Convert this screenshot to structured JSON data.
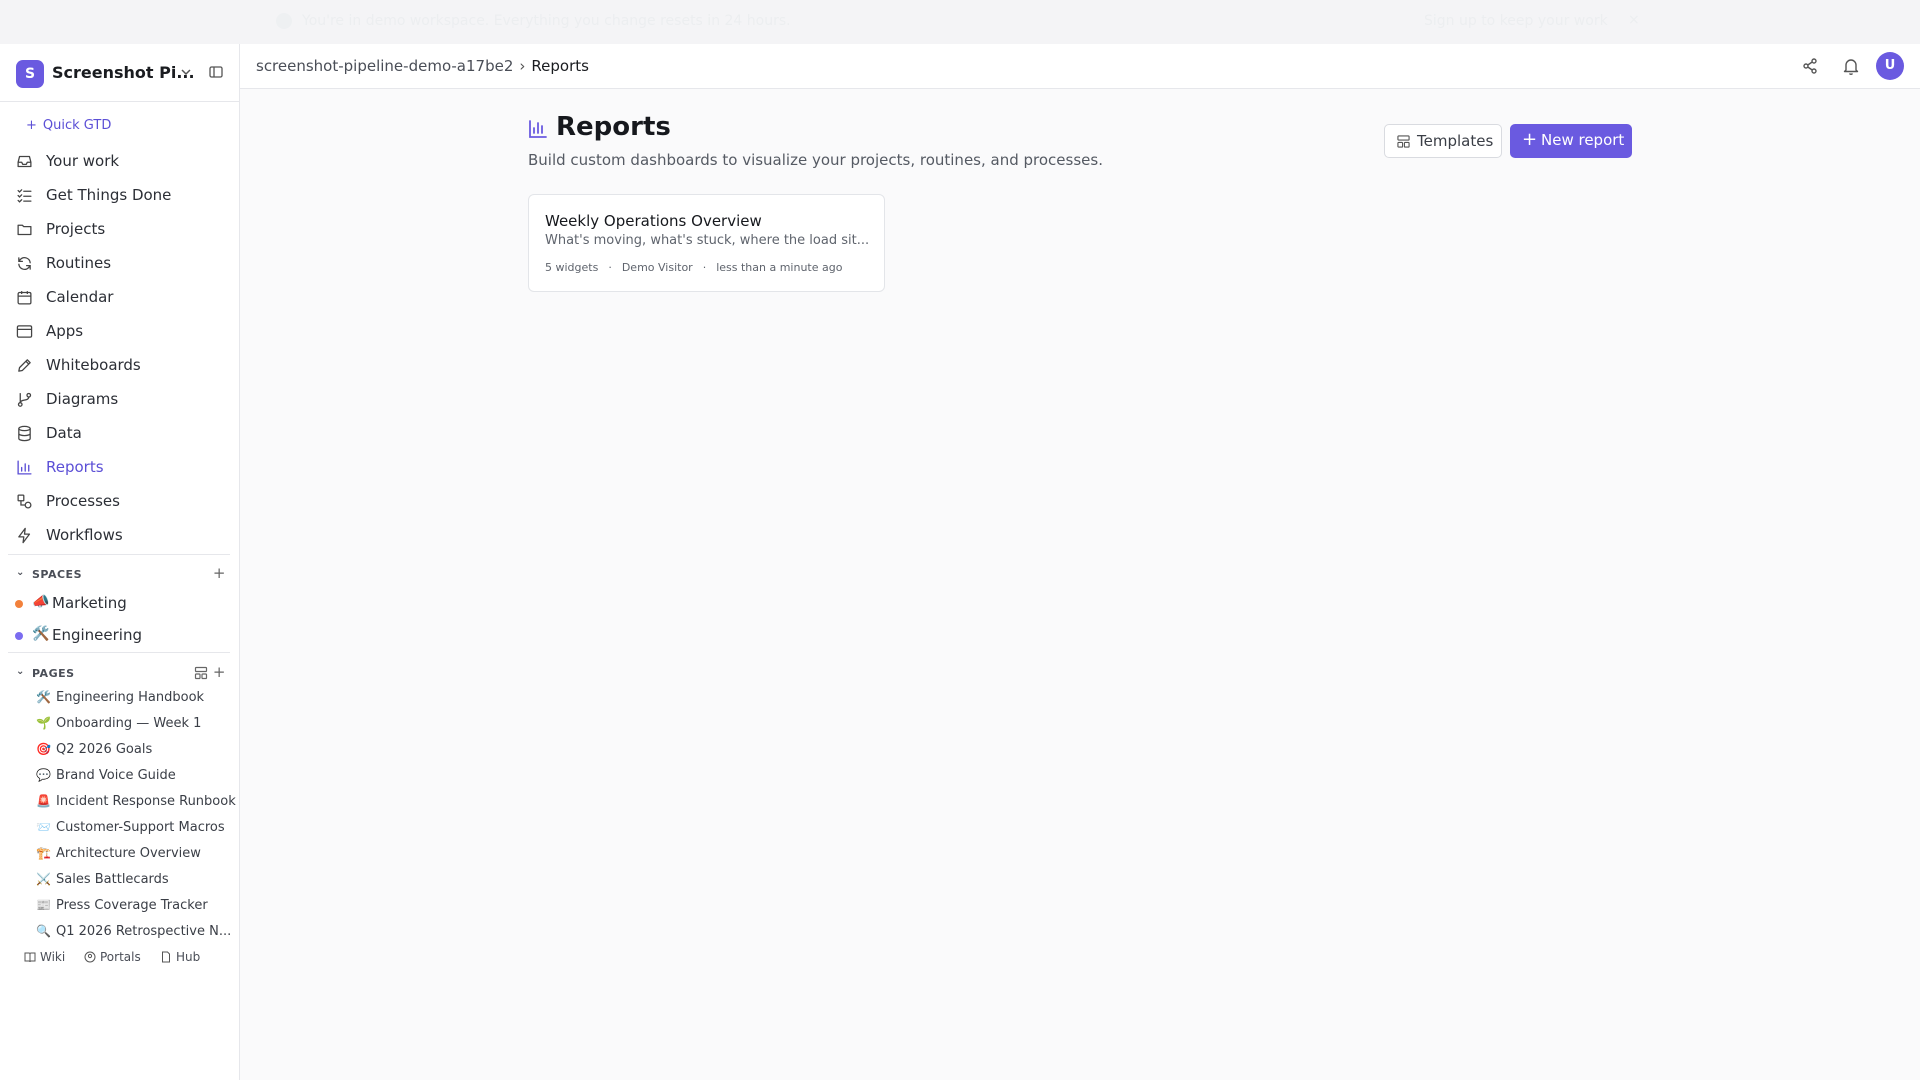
{
  "banner": {
    "message": "You're in demo workspace. Everything you change resets in 24 hours.",
    "action": "Sign up to keep your work"
  },
  "workspace": {
    "avatar_letter": "S",
    "name": "Screenshot Pi..."
  },
  "sidebar": {
    "quick_gtd": "Quick GTD",
    "nav": [
      {
        "label": "Your work",
        "icon": "inbox-icon"
      },
      {
        "label": "Get Things Done",
        "icon": "checklist-icon"
      },
      {
        "label": "Projects",
        "icon": "folder-icon"
      },
      {
        "label": "Routines",
        "icon": "refresh-icon"
      },
      {
        "label": "Calendar",
        "icon": "calendar-icon"
      },
      {
        "label": "Apps",
        "icon": "app-window-icon"
      },
      {
        "label": "Whiteboards",
        "icon": "pencil-icon"
      },
      {
        "label": "Diagrams",
        "icon": "git-branch-icon"
      },
      {
        "label": "Data",
        "icon": "database-icon"
      },
      {
        "label": "Reports",
        "icon": "bar-chart-icon",
        "active": true
      },
      {
        "label": "Processes",
        "icon": "shapes-icon"
      },
      {
        "label": "Workflows",
        "icon": "lightning-icon"
      }
    ],
    "spaces_header": "SPACES",
    "spaces": [
      {
        "emoji": "📣",
        "label": "Marketing",
        "color": "#f2813b"
      },
      {
        "emoji": "🛠️",
        "label": "Engineering",
        "color": "#7b6cf0"
      }
    ],
    "pages_header": "PAGES",
    "pages": [
      {
        "emoji": "🛠️",
        "label": "Engineering Handbook"
      },
      {
        "emoji": "🌱",
        "label": "Onboarding — Week 1"
      },
      {
        "emoji": "🎯",
        "label": "Q2 2026 Goals"
      },
      {
        "emoji": "💬",
        "label": "Brand Voice Guide"
      },
      {
        "emoji": "🚨",
        "label": "Incident Response Runbook"
      },
      {
        "emoji": "📨",
        "label": "Customer-Support Macros"
      },
      {
        "emoji": "🏗️",
        "label": "Architecture Overview"
      },
      {
        "emoji": "⚔️",
        "label": "Sales Battlecards"
      },
      {
        "emoji": "📰",
        "label": "Press Coverage Tracker"
      },
      {
        "emoji": "🔍",
        "label": "Q1 2026 Retrospective N..."
      }
    ],
    "footer": {
      "wiki": "Wiki",
      "portals": "Portals",
      "hub": "Hub"
    }
  },
  "breadcrumb": {
    "workspace": "screenshot-pipeline-demo-a17be2",
    "current": "Reports"
  },
  "user_avatar": "U",
  "main": {
    "title": "Reports",
    "subtitle": "Build custom dashboards to visualize your projects, routines, and processes.",
    "templates_button": "Templates",
    "new_report_button": "New report",
    "reports": [
      {
        "title": "Weekly Operations Overview",
        "description": "What's moving, what's stuck, where the load sit...",
        "widgets": "5 widgets",
        "author": "Demo Visitor",
        "updated": "less than a minute ago"
      }
    ]
  },
  "colors": {
    "accent": "#6a5ae0",
    "accent_text": "#5b4fd6"
  }
}
